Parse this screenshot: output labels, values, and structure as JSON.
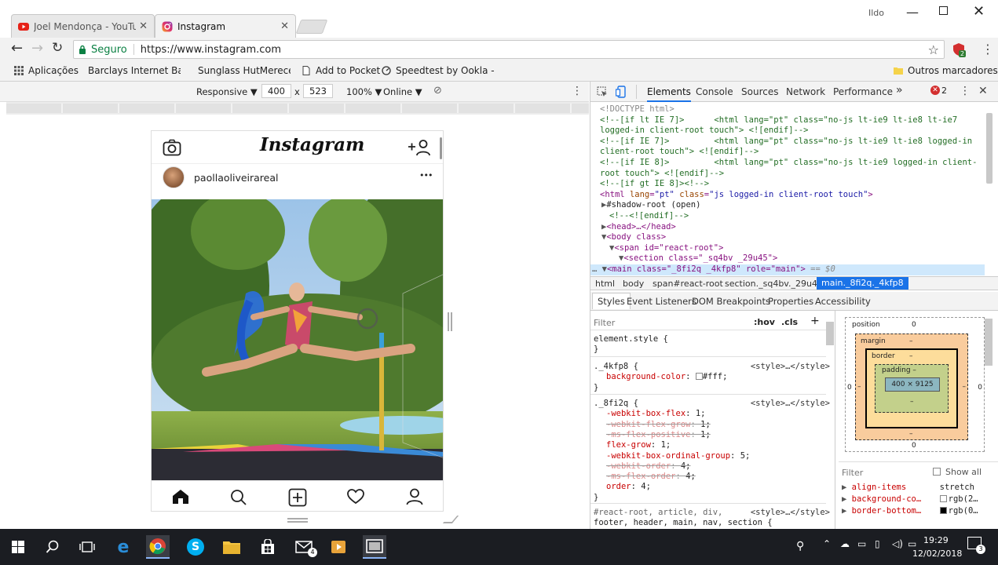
{
  "tabs": [
    {
      "title": "Joel Mendonça - YouTub",
      "icon": "youtube-icon"
    },
    {
      "title": "Instagram",
      "icon": "instagram-icon"
    }
  ],
  "window": {
    "user_label": "Ildo"
  },
  "omnibox": {
    "secure_label": "Seguro",
    "url": "https://www.instagram.com",
    "extension_badge": "2"
  },
  "bookmarks": [
    {
      "label": "Aplicações"
    },
    {
      "label": "Barclays Internet Ban"
    },
    {
      "label": "Sunglass HutMereces"
    },
    {
      "label": "Add to Pocket"
    },
    {
      "label": "Speedtest by Ookla -"
    }
  ],
  "other_bookmarks": "Outros marcadores",
  "device": {
    "mode": "Responsive",
    "width": "400",
    "height": "523",
    "x": "x",
    "zoom": "100%",
    "network": "Online"
  },
  "instagram": {
    "logo": "Instagram",
    "username": "paollaoliveirareal",
    "more": "•••"
  },
  "devtools": {
    "tabs": [
      "Elements",
      "Console",
      "Sources",
      "Network",
      "Performance"
    ],
    "more": "»",
    "error_count": "2",
    "dom": [
      "<!DOCTYPE html>",
      "<!--[if lt IE 7]>      <html lang=\"pt\" class=\"no-js lt-ie9 lt-ie8 lt-ie7",
      "logged-in client-root touch\"> <![endif]-->",
      "<!--[if IE 7]>         <html lang=\"pt\" class=\"no-js lt-ie9 lt-ie8 logged-in",
      "client-root touch\"> <![endif]-->",
      "<!--[if IE 8]>         <html lang=\"pt\" class=\"no-js lt-ie9 logged-in client-",
      "root touch\"> <![endif]-->",
      "<!--[if gt IE 8]><!-->"
    ],
    "html_tag": {
      "open": "<html ",
      "lang_attr": "lang",
      "lang_val": "\"pt\"",
      "class_attr": "class",
      "class_val": "\"js logged-in client-root touch\"",
      "close": ">"
    },
    "shadow_root": "#shadow-root (open)",
    "endif": "<!--<![endif]-->",
    "head": "<head>…</head>",
    "body": "<body class>",
    "span": "<span id=\"react-root\">",
    "section": "<section class=\"_sq4bv _29u45\">",
    "main": "<main class=\"_8fi2q _4kfp8\" role=\"main\">",
    "main_suffix": " == $0",
    "breadcrumbs": [
      "html",
      "body",
      "span#react-root",
      "section._sq4bv._29u45",
      "main._8fi2q._4kfp8"
    ],
    "subtabs": [
      "Styles",
      "Event Listeners",
      "DOM Breakpoints",
      "Properties",
      "Accessibility"
    ],
    "filter_placeholder": "Filter",
    "hov": ":hov",
    "cls": ".cls",
    "plus": "+",
    "element_style": "element.style {",
    "close_brace": "}",
    "rule1": {
      "selector": "._4kfp8 {",
      "source": "<style>…</style>",
      "props": [
        {
          "name": "background-color",
          "value": "#fff;",
          "swatch": "#ffffff"
        }
      ]
    },
    "rule2": {
      "selector": "._8fi2q {",
      "source": "<style>…</style>",
      "props": [
        {
          "name": "-webkit-box-flex",
          "value": "1;",
          "struck": false
        },
        {
          "name": "-webkit-flex-grow",
          "value": "1;",
          "struck": true
        },
        {
          "name": "-ms-flex-positive",
          "value": "1;",
          "struck": true
        },
        {
          "name": "flex-grow",
          "value": "1;",
          "struck": false
        },
        {
          "name": "-webkit-box-ordinal-group",
          "value": "5;",
          "struck": false
        },
        {
          "name": "-webkit-order",
          "value": "4;",
          "struck": true
        },
        {
          "name": "-ms-flex-order",
          "value": "4;",
          "struck": true
        },
        {
          "name": "order",
          "value": "4;",
          "struck": false
        }
      ]
    },
    "rule3": {
      "selector": "#react-root, article, div,",
      "selector2": "footer, header, main, nav, section {",
      "source": "<style>…</style>"
    },
    "boxmodel": {
      "position_label": "position",
      "position_val": "0",
      "margin_label": "margin",
      "margin_val": "–",
      "border_label": "border",
      "border_val": "–",
      "padding_label": "padding –",
      "content": "400 × 9125",
      "dash": "–",
      "zero": "0"
    },
    "computed_filter": "Filter",
    "show_all": "Show all",
    "computed": [
      {
        "name": "align-items",
        "value": "stretch",
        "swatch": ""
      },
      {
        "name": "background-co…",
        "value": "rgb(2…",
        "swatch": "#ffffff"
      },
      {
        "name": "border-bottom…",
        "value": "rgb(0…",
        "swatch": "#000000"
      }
    ]
  },
  "taskbar": {
    "time": "19:29",
    "date": "12/02/2018",
    "notifications": "3",
    "mail_badge": "4"
  }
}
